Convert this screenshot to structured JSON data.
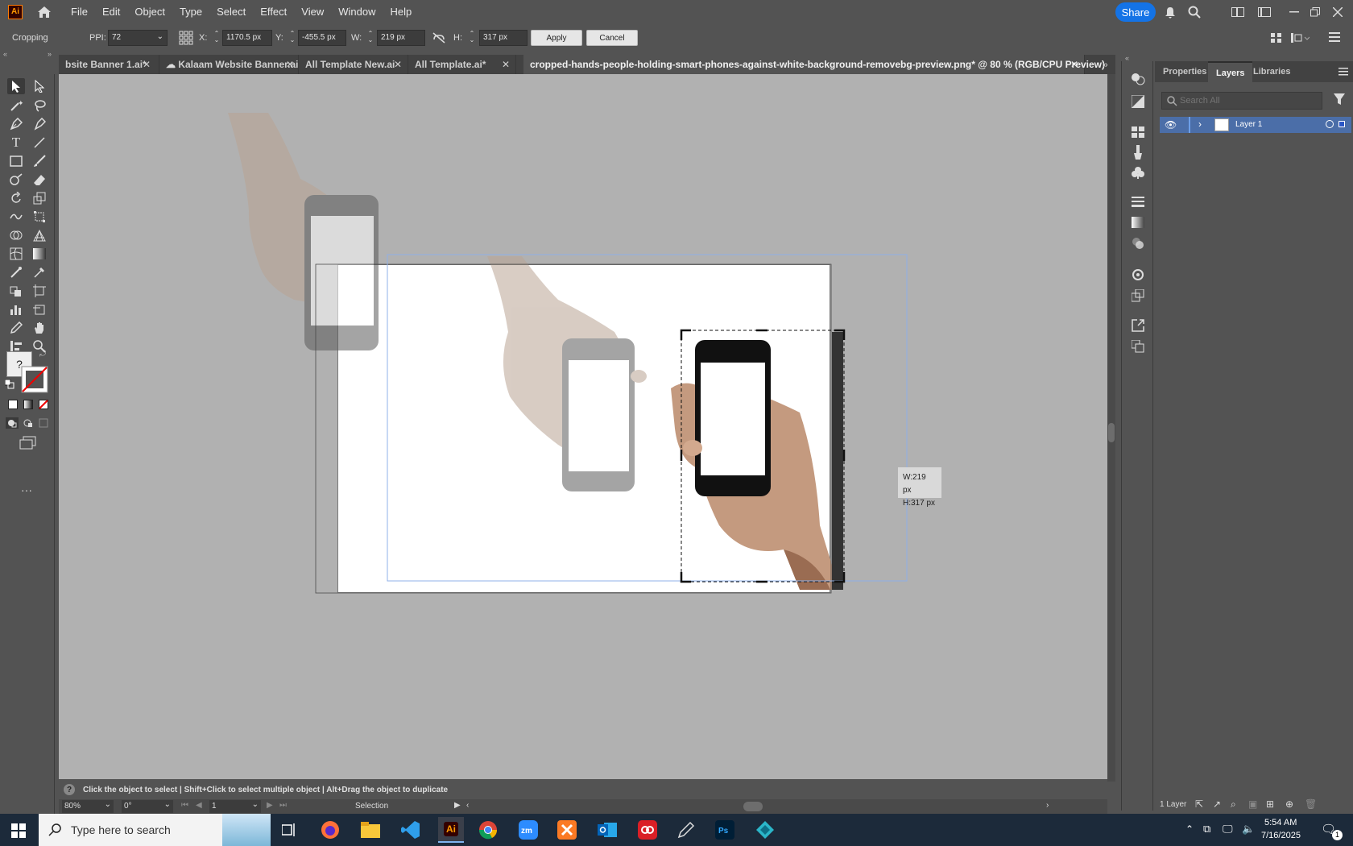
{
  "app": {
    "logo_text": "Ai"
  },
  "menu": [
    "File",
    "Edit",
    "Object",
    "Type",
    "Select",
    "Effect",
    "View",
    "Window",
    "Help"
  ],
  "share_label": "Share",
  "controlbar": {
    "mode": "Cropping",
    "ppi_label": "PPI:",
    "ppi_value": "72",
    "x_label": "X:",
    "x_value": "1170.5 px",
    "y_label": "Y:",
    "y_value": "-455.5 px",
    "w_label": "W:",
    "w_value": "219 px",
    "h_label": "H:",
    "h_value": "317 px",
    "apply": "Apply",
    "cancel": "Cancel"
  },
  "tabs": [
    {
      "label": "bsite Banner 1.ai*"
    },
    {
      "label": "Kalaam Website Banner.aic"
    },
    {
      "label": "All Template New.ai"
    },
    {
      "label": "All Template.ai*"
    },
    {
      "label": "cropped-hands-people-holding-smart-phones-against-white-background-removebg-preview.png* @ 80 % (RGB/CPU Preview)"
    }
  ],
  "tooltip": {
    "w": "W:219 px",
    "h": "H:317 px"
  },
  "tools": {
    "unknown_fill": "?"
  },
  "hint": "Click the object to select  |  Shift+Click to select multiple object  |  Alt+Drag the object to duplicate",
  "status": {
    "zoom": "80%",
    "rotation": "0°",
    "artboard": "1",
    "tool": "Selection"
  },
  "panel": {
    "tabs": [
      "Properties",
      "Layers",
      "Libraries"
    ],
    "search_placeholder": "Search All",
    "layer_name": "Layer 1",
    "footer_count": "1 Layer"
  },
  "taskbar": {
    "search_placeholder": "Type here to search",
    "time": "5:54 AM",
    "date": "7/16/2025",
    "notif_count": "1",
    "apps": [
      "firefox",
      "file-explorer",
      "vscode",
      "illustrator",
      "chrome",
      "zoom",
      "xampp",
      "outlook",
      "creative-cloud",
      "pen-tool",
      "photoshop",
      "app"
    ]
  }
}
